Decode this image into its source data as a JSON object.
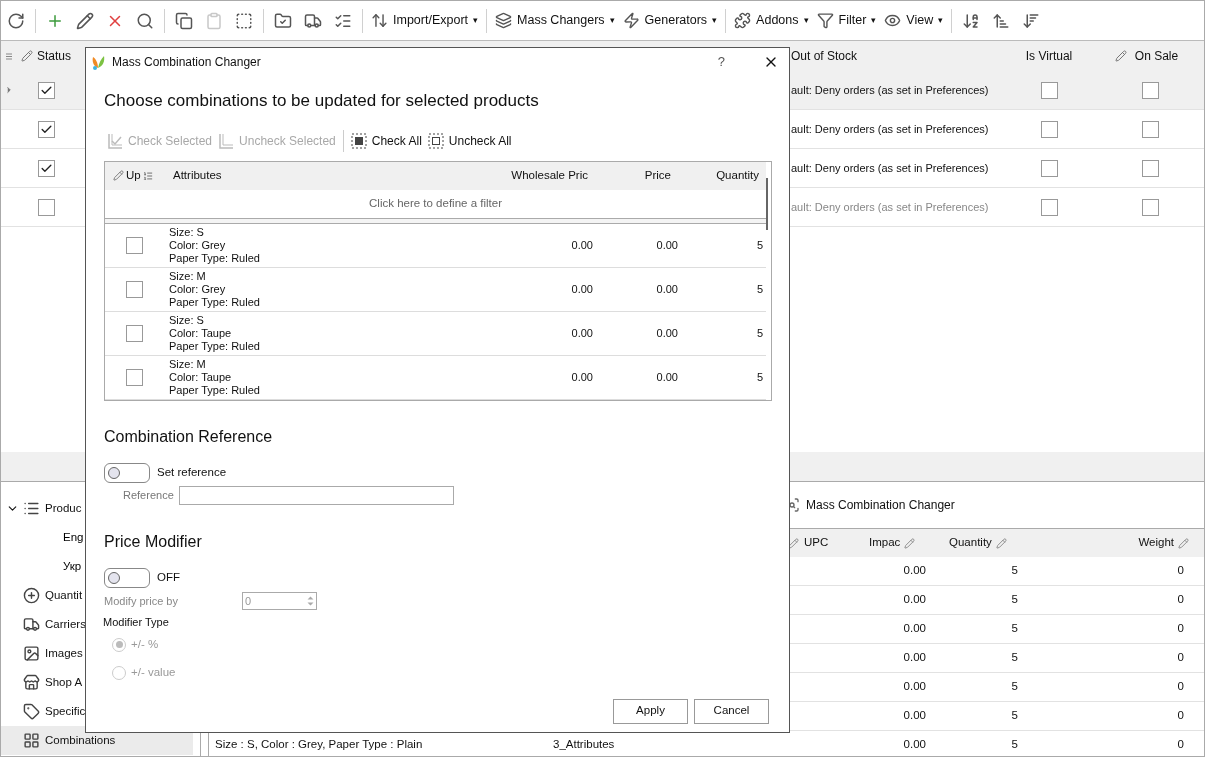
{
  "toolbar": {
    "menus": [
      {
        "label": "Import/Export",
        "kind": "import"
      },
      {
        "label": "Mass Changers",
        "kind": "mass"
      },
      {
        "label": "Generators",
        "kind": "generators"
      },
      {
        "label": "Addons",
        "kind": "addons"
      },
      {
        "label": "Filter",
        "kind": "filter"
      },
      {
        "label": "View",
        "kind": "view"
      }
    ],
    "dropdown_mark": "▾"
  },
  "products": {
    "columns": {
      "status": "Status",
      "out_of_stock": "Out of Stock",
      "is_virtual": "Is Virtual",
      "on_sale": "On Sale"
    },
    "rows": [
      {
        "selected": true,
        "status_checked": true,
        "out_of_stock": "ault: Deny orders (as set in Preferences)",
        "is_virtual": false,
        "on_sale": false,
        "disabled": false
      },
      {
        "selected": false,
        "status_checked": true,
        "out_of_stock": "ault: Deny orders (as set in Preferences)",
        "is_virtual": false,
        "on_sale": false,
        "disabled": false
      },
      {
        "selected": false,
        "status_checked": true,
        "out_of_stock": "ault: Deny orders (as set in Preferences)",
        "is_virtual": false,
        "on_sale": false,
        "disabled": false
      },
      {
        "selected": false,
        "status_checked": false,
        "out_of_stock": "ault: Deny orders (as set in Preferences)",
        "is_virtual": false,
        "on_sale": false,
        "disabled": true
      }
    ]
  },
  "tree": [
    {
      "label": "Produc",
      "kind": "list",
      "expanded": true,
      "selected": false,
      "children": [
        {
          "label": "Eng",
          "selected": false
        },
        {
          "label": "Укр",
          "selected": false
        }
      ]
    },
    {
      "label": "Quantit",
      "kind": "quantity",
      "selected": false
    },
    {
      "label": "Carriers",
      "kind": "truck",
      "selected": false
    },
    {
      "label": "Images",
      "kind": "image",
      "selected": false
    },
    {
      "label": "Shop A",
      "kind": "shop",
      "selected": false
    },
    {
      "label": "Specific",
      "kind": "tag",
      "selected": false
    },
    {
      "label": "Combinations",
      "kind": "grid",
      "selected": true
    }
  ],
  "combinations_panel": {
    "link": "Mass Combination Changer",
    "columns": {
      "upc": "UPC",
      "impact": "Impac",
      "quantity": "Quantity",
      "weight": "Weight"
    },
    "rows": [
      {
        "impact": "0.00",
        "quantity": "5",
        "weight": "0"
      },
      {
        "impact": "0.00",
        "quantity": "5",
        "weight": "0"
      },
      {
        "impact": "0.00",
        "quantity": "5",
        "weight": "0"
      },
      {
        "impact": "0.00",
        "quantity": "5",
        "weight": "0"
      },
      {
        "impact": "0.00",
        "quantity": "5",
        "weight": "0"
      },
      {
        "impact": "0.00",
        "quantity": "5",
        "weight": "0"
      },
      {
        "attributes": "Size : S, Color : Grey, Paper Type : Plain",
        "count": "3_Attributes",
        "impact": "0.00",
        "quantity": "5",
        "weight": "0"
      }
    ]
  },
  "dialog": {
    "title": "Mass Combination Changer",
    "help": "?",
    "heading": "Choose combinations to be updated for selected products",
    "actions": [
      {
        "label": "Check Selected",
        "kind": "check_selected",
        "disabled": true
      },
      {
        "label": "Uncheck Selected",
        "kind": "uncheck_selected",
        "disabled": true
      },
      {
        "label": "Check All",
        "kind": "check_all",
        "disabled": false
      },
      {
        "label": "Uncheck All",
        "kind": "uncheck_all",
        "disabled": false
      }
    ],
    "table": {
      "columns": {
        "up": "Up",
        "attributes": "Attributes",
        "wholesale_price": "Wholesale Pric",
        "price": "Price",
        "quantity": "Quantity"
      },
      "filter_hint": "Click here to define a filter",
      "rows": [
        {
          "checked": false,
          "attributes": [
            "Size: S",
            "Color: Grey",
            "Paper Type: Ruled"
          ],
          "wholesale_price": "0.00",
          "price": "0.00",
          "quantity": "5"
        },
        {
          "checked": false,
          "attributes": [
            "Size: M",
            "Color: Grey",
            "Paper Type: Ruled"
          ],
          "wholesale_price": "0.00",
          "price": "0.00",
          "quantity": "5"
        },
        {
          "checked": false,
          "attributes": [
            "Size: S",
            "Color: Taupe",
            "Paper Type: Ruled"
          ],
          "wholesale_price": "0.00",
          "price": "0.00",
          "quantity": "5"
        },
        {
          "checked": false,
          "attributes": [
            "Size: M",
            "Color: Taupe",
            "Paper Type: Ruled"
          ],
          "wholesale_price": "0.00",
          "price": "0.00",
          "quantity": "5"
        }
      ]
    },
    "reference": {
      "heading": "Combination Reference",
      "toggle_on": false,
      "toggle_label": "Set reference",
      "field_label": "Reference"
    },
    "price_modifier": {
      "heading": "Price Modifier",
      "toggle_on": false,
      "toggle_label": "OFF",
      "field_label": "Modify price by",
      "value": "0",
      "type_label": "Modifier Type",
      "options": [
        {
          "label": "+/- %",
          "selected": true
        },
        {
          "label": "+/- value",
          "selected": false
        }
      ]
    },
    "buttons": [
      {
        "label": "Apply"
      },
      {
        "label": "Cancel"
      }
    ]
  }
}
